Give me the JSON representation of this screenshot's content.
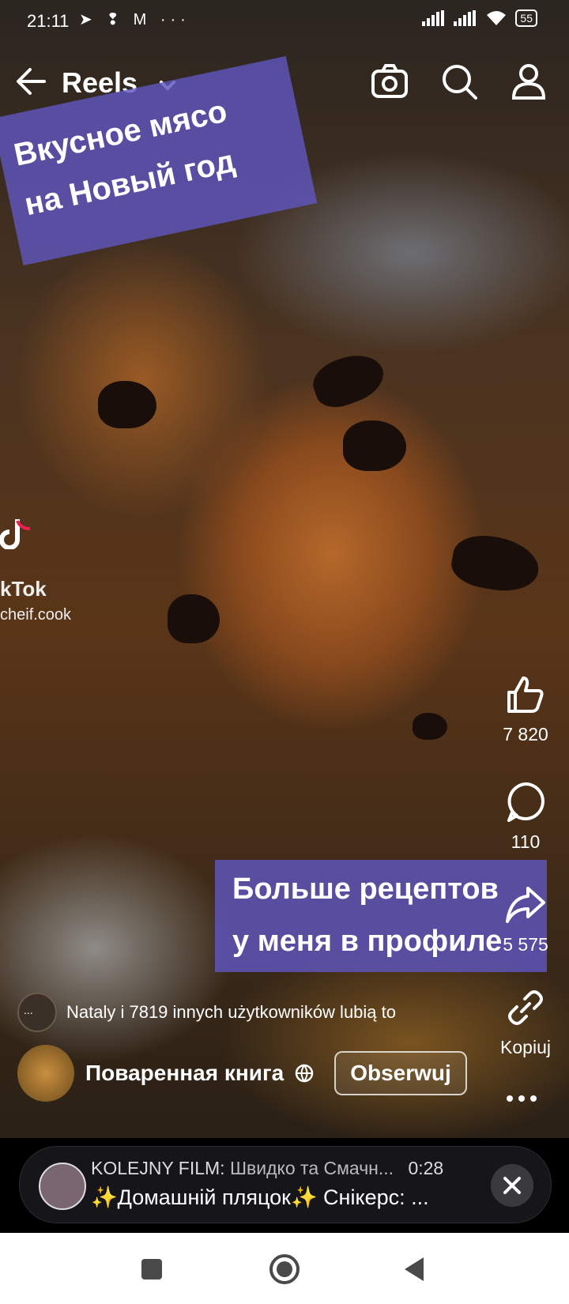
{
  "status_bar": {
    "time": "21:11",
    "left_icons": "➤ ❢ M ···",
    "battery": "55"
  },
  "header": {
    "back_icon": "arrow-left-icon",
    "title": "Reels",
    "dropdown_icon": "chevron-down-icon",
    "actions": [
      "camera-icon",
      "search-icon",
      "profile-icon"
    ]
  },
  "overlay_text": {
    "title_line1": "Вкусное мясо",
    "title_line2": "на Новый год",
    "promo_line1": "Больше рецептов",
    "promo_line2": "у меня в профиле"
  },
  "watermark": {
    "brand": "kTok",
    "handle": "cheif.cook"
  },
  "actions": {
    "like_count": "7 820",
    "comment_count": "110",
    "share_count": "5 575",
    "copy_label": "Kopiuj"
  },
  "likers": {
    "avatar_text": "...",
    "text": "Nataly i 7819 innych użytkowników lubią to"
  },
  "author": {
    "name": "Поваренная книга",
    "follow_label": "Obserwuj"
  },
  "next_video": {
    "prefix": "KOLEJNY FILM:",
    "title": "Швидко та Смачн...",
    "duration": "0:28",
    "subtitle": "✨Домашній пляцок✨ Снікерс: ..."
  },
  "nav": [
    "recents-button",
    "home-button",
    "back-button"
  ],
  "colors": {
    "banner": "#5f55be",
    "next_bar": "#16161a"
  }
}
